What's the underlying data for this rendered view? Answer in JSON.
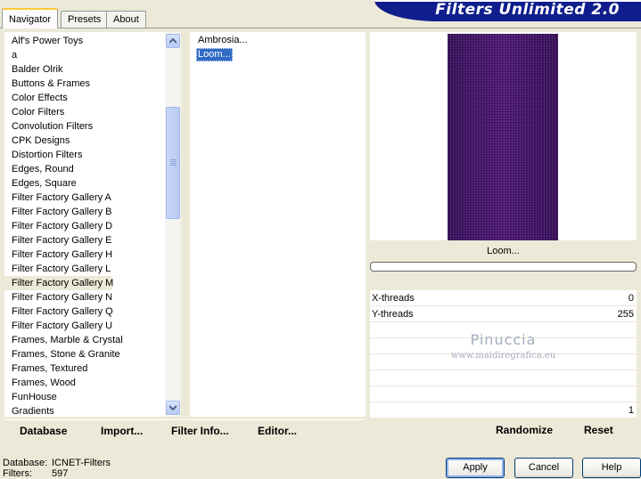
{
  "tabs": [
    {
      "label": "Navigator",
      "active": true
    },
    {
      "label": "Presets",
      "active": false
    },
    {
      "label": "About",
      "active": false
    }
  ],
  "logo": {
    "text": "Filters Unlimited 2.0",
    "color": "#0f1e8c"
  },
  "categories": {
    "items": [
      "Alf's Power Toys",
      "a",
      "Balder Olrik",
      "Buttons & Frames",
      "Color Effects",
      "Color Filters",
      "Convolution Filters",
      "CPK Designs",
      "Distortion Filters",
      "Edges, Round",
      "Edges, Square",
      "Filter Factory Gallery A",
      "Filter Factory Gallery B",
      "Filter Factory Gallery D",
      "Filter Factory Gallery E",
      "Filter Factory Gallery H",
      "Filter Factory Gallery L",
      "Filter Factory Gallery M",
      "Filter Factory Gallery N",
      "Filter Factory Gallery Q",
      "Filter Factory Gallery U",
      "Frames, Marble & Crystal",
      "Frames, Stone & Granite",
      "Frames, Textured",
      "Frames, Wood",
      "FunHouse",
      "Gradients"
    ],
    "selected": "Filter Factory Gallery M"
  },
  "filters": {
    "items": [
      "Ambrosia...",
      "Loom..."
    ],
    "selected": "Loom..."
  },
  "preview": {
    "filter_name": "Loom...",
    "image_color": "#3a0f5c"
  },
  "params": [
    {
      "label": "X-threads",
      "value": "0"
    },
    {
      "label": "Y-threads",
      "value": "255"
    },
    {
      "label": "",
      "value": ""
    },
    {
      "label": "",
      "value": ""
    },
    {
      "label": "",
      "value": ""
    },
    {
      "label": "",
      "value": ""
    },
    {
      "label": "",
      "value": ""
    },
    {
      "label": "",
      "value": "1"
    }
  ],
  "watermark": {
    "line1": "Pinuccia",
    "line2": "www.maidiregrafica.eu"
  },
  "toolbar": {
    "database": "Database",
    "import": "Import...",
    "filter_info": "Filter Info...",
    "editor": "Editor...",
    "randomize": "Randomize",
    "reset": "Reset"
  },
  "status": {
    "database_label": "Database:",
    "database_value": "ICNET-Filters",
    "filters_label": "Filters:",
    "filters_value": "597"
  },
  "buttons": {
    "apply": "Apply",
    "cancel": "Cancel",
    "help": "Help"
  }
}
